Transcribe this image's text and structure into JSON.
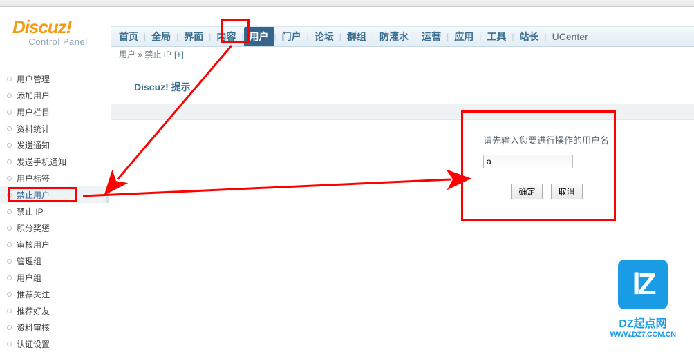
{
  "logo": {
    "main": "Discuz!",
    "sub": "Control Panel"
  },
  "topnav": {
    "items": [
      "首页",
      "全局",
      "界面",
      "内容",
      "用户",
      "门户",
      "论坛",
      "群组",
      "防灌水",
      "运营",
      "应用",
      "工具",
      "站长",
      "UCenter"
    ],
    "active_index": 4
  },
  "breadcrumb": {
    "path": "用户 » 禁止 IP",
    "plus": "[+]"
  },
  "sidebar": {
    "items": [
      "用户管理",
      "添加用户",
      "用户栏目",
      "资料统计",
      "发送通知",
      "发送手机通知",
      "用户标签",
      "禁止用户",
      "禁止 IP",
      "积分奖惩",
      "审核用户",
      "管理组",
      "用户组",
      "推荐关注",
      "推荐好友",
      "资料审核",
      "认证设置"
    ],
    "selected_index": 7
  },
  "main": {
    "hint_title": "Discuz! 提示"
  },
  "dialog": {
    "label": "请先输入您要进行操作的用户名",
    "value": "a",
    "confirm": "确定",
    "cancel": "取消"
  },
  "watermark": {
    "logo_letters": "lZ",
    "line1": "DZ起点网",
    "line2": "WWW.DZ7.COM.CN"
  }
}
